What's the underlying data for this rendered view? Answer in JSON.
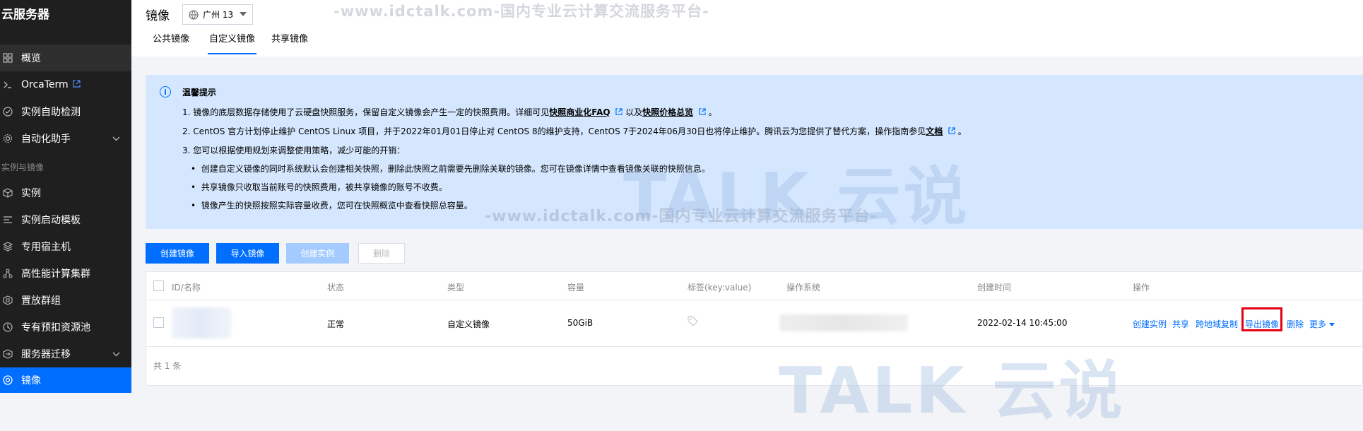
{
  "sidebar": {
    "title": "云服务器",
    "group_label": "实例与镜像",
    "items": [
      {
        "label": "概览",
        "icon": "grid-icon"
      },
      {
        "label": "OrcaTerm",
        "icon": "terminal-icon"
      },
      {
        "label": "实例自助检测",
        "icon": "check-icon"
      },
      {
        "label": "自动化助手",
        "icon": "gear-icon"
      },
      {
        "label": "实例",
        "icon": "cube-icon"
      },
      {
        "label": "实例启动模板",
        "icon": "template-icon"
      },
      {
        "label": "专用宿主机",
        "icon": "host-icon"
      },
      {
        "label": "高性能计算集群",
        "icon": "cluster-icon"
      },
      {
        "label": "置放群组",
        "icon": "group-icon"
      },
      {
        "label": "专有预扣资源池",
        "icon": "pool-icon"
      },
      {
        "label": "服务器迁移",
        "icon": "migrate-icon"
      },
      {
        "label": "镜像",
        "icon": "image-icon"
      }
    ]
  },
  "header": {
    "title": "镜像",
    "region": "广州 13",
    "tabs": [
      "公共镜像",
      "自定义镜像",
      "共享镜像"
    ],
    "watermark": "-www.idctalk.com-国内专业云计算交流服务平台-"
  },
  "notice": {
    "title": "温馨提示",
    "line1_a": "1. 镜像的底层数据存储使用了云硬盘快照服务，保留自定义镜像会产生一定的快照费用。详细可见",
    "link1": "快照商业化FAQ",
    "line1_b": "以及",
    "link2": "快照价格总览",
    "line1_c": "。",
    "line2_a": "2. CentOS 官方计划停止维护 CentOS Linux 项目，并于2022年01月01日停止对 CentOS 8的维护支持，CentOS 7于2024年06月30日也将停止维护。腾讯云为您提供了替代方案，操作指南参见",
    "link3": "文档",
    "line2_c": "。",
    "line3": "3. 您可以根据使用规划来调整使用策略，减少可能的开销：",
    "bullets": [
      "创建自定义镜像的同时系统默认会创建相关快照，删除此快照之前需要先删除关联的镜像。您可在镜像详情中查看镜像关联的快照信息。",
      "共享镜像只收取当前账号的快照费用，被共享镜像的账号不收费。",
      "镜像产生的快照按照实际容量收费，您可在快照概览中查看快照总容量。"
    ],
    "watermark": "-www.idctalk.com-国内专业云计算交流服务平台-"
  },
  "logo_watermark": "TALK 云说",
  "toolbar": {
    "create": "创建镜像",
    "import": "导入镜像",
    "create_instance": "创建实例",
    "delete": "删除"
  },
  "table": {
    "columns": [
      "ID/名称",
      "状态",
      "类型",
      "容量",
      "标签(key:value)",
      "操作系统",
      "创建时间",
      "操作"
    ],
    "rows": [
      {
        "status": "正常",
        "type": "自定义镜像",
        "capacity": "50GiB",
        "created": "2022-02-14 10:45:00"
      }
    ],
    "actions": [
      "创建实例",
      "共享",
      "跨地域复制",
      "导出镜像",
      "删除",
      "更多"
    ],
    "total": "共 1 条"
  }
}
